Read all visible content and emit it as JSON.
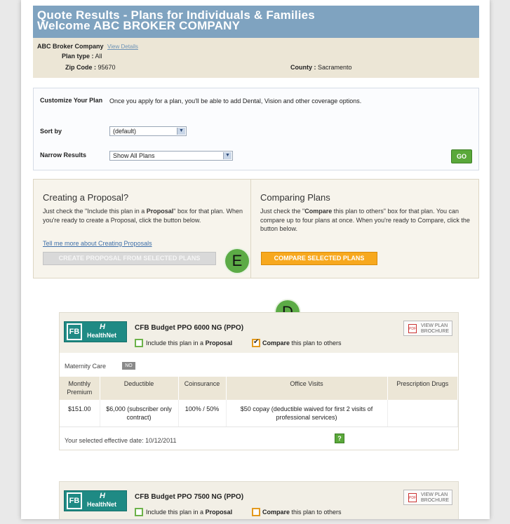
{
  "header": {
    "title": "Quote Results - Plans for Individuals & Families",
    "welcome": "Welcome ABC BROKER COMPANY",
    "broker": "ABC Broker Company",
    "view_details": "View Details",
    "plan_type_label": "Plan type :",
    "plan_type": "All",
    "zip_label": "Zip Code :",
    "zip": "95670",
    "county_label": "County :",
    "county": "Sacramento"
  },
  "customize": {
    "label": "Customize Your Plan",
    "message": "Once you apply for a plan, you'll be able to add Dental, Vision and other coverage options.",
    "sort_label": "Sort by",
    "sort_value": "(default)",
    "narrow_label": "Narrow Results",
    "narrow_value": "Show All Plans",
    "go_label": "GO"
  },
  "proposal": {
    "title": "Creating a Proposal?",
    "text_1": "Just check the \"Include this plan in a ",
    "text_bold": "Proposal",
    "text_2": "\" box for that plan. When you're ready to create a Proposal, click the button below.",
    "link": "Tell me more about Creating Proposals",
    "button": "CREATE PROPOSAL FROM SELECTED PLANS"
  },
  "comparing": {
    "title": "Comparing Plans",
    "text_1": "Just check the \"",
    "text_bold": "Compare",
    "text_2": " this plan to others\" box for that plan. You can compare up to four plans at once. When you're ready to Compare, click the button below.",
    "button": "COMPARE SELECTED PLANS"
  },
  "markers": {
    "e": "E",
    "d": "D"
  },
  "plans": [
    {
      "name": "CFB Budget PPO 6000 NG (PPO)",
      "include_1": "Include this plan in a ",
      "include_bold": "Proposal",
      "compare_bold": "Compare",
      "compare_2": " this plan to others",
      "brochure": "VIEW PLAN BROCHURE",
      "maternity_label": "Maternity Care",
      "maternity_value": "NO",
      "headers": [
        "Monthly Premium",
        "Deductible",
        "Coinsurance",
        "Office Visits",
        "Prescription Drugs"
      ],
      "row": [
        "$151.00",
        "$6,000 (subscriber only contract)",
        "100% / 50%",
        "$50 copay (deductible waived for first 2 visits of professional services)",
        ""
      ],
      "effective_date": "Your selected effective date: 10/12/2011",
      "help": "?"
    },
    {
      "name": "CFB Budget PPO 7500 NG (PPO)",
      "include_1": "Include this plan in a ",
      "include_bold": "Proposal",
      "compare_bold": "Compare",
      "compare_2": " this plan to others",
      "brochure": "VIEW PLAN BROCHURE"
    }
  ],
  "logo": {
    "mark": "FB",
    "name": "HealthNet",
    "hx": "H"
  },
  "colors": {
    "header_blue": "#7fa3c0",
    "go_green": "#5aa83a",
    "compare_orange": "#f7a81e",
    "marker_green": "#5cab46"
  }
}
